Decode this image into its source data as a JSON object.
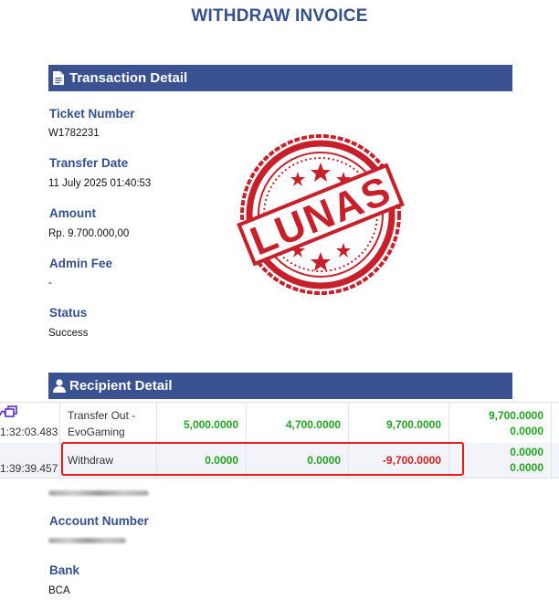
{
  "page": {
    "title": "WITHDRAW INVOICE"
  },
  "transaction": {
    "section_title": "Transaction Detail",
    "ticket_label": "Ticket Number",
    "ticket_value": "W1782231",
    "date_label": "Transfer Date",
    "date_value": "11 July 2025 01:40:53",
    "amount_label": "Amount",
    "amount_value": "Rp. 9.700.000,00",
    "fee_label": "Admin Fee",
    "fee_value": "-",
    "status_label": "Status",
    "status_value": "Success"
  },
  "stamp": {
    "text": "LUNAS",
    "color": "#c8202a"
  },
  "recipient": {
    "section_title": "Recipient Detail",
    "account_number_label": "Account Number",
    "bank_label": "Bank",
    "bank_value": "BCA"
  },
  "overlay_table": {
    "rows": [
      {
        "time": "1:32:03.483",
        "description_line1": "Transfer Out -",
        "description_line2": "EvoGaming",
        "amount1": "5,000.0000",
        "amount2": "4,700.0000",
        "amount3": "9,700.0000",
        "balance_top": "9,700.0000",
        "balance_bottom": "0.0000"
      },
      {
        "time": "1:39:39.457",
        "description": "Withdraw",
        "amount1": "0.0000",
        "amount2": "0.0000",
        "amount3": "-9,700.0000",
        "balance_top": "0.0000",
        "balance_bottom": "0.0000"
      }
    ],
    "positive_color": "#1fa51f",
    "negative_color": "#d21e1e",
    "highlight_color": "#e81a1a"
  },
  "icons": {
    "transaction_icon": "document-icon",
    "recipient_icon": "user-icon",
    "copy_icon": "copy-icon"
  }
}
